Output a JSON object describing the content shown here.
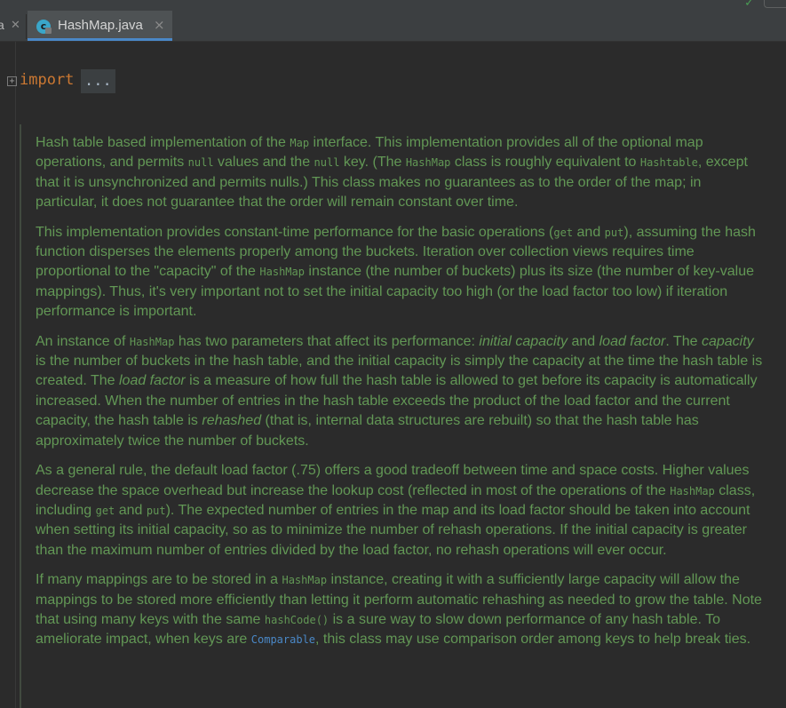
{
  "tabs": {
    "prev_fragment": "a",
    "active": {
      "title": "HashMap.java",
      "icon": "java-class-icon"
    }
  },
  "editor": {
    "import_keyword": "import",
    "import_folded": "..."
  },
  "doc": {
    "colors": {
      "text": "#629755",
      "link": "#4a88c7"
    },
    "paragraphs": [
      [
        {
          "t": "Hash table based implementation of the "
        },
        {
          "t": "Map",
          "c": 1
        },
        {
          "t": " interface. This implementation provides all of the optional map operations, and permits "
        },
        {
          "t": "null",
          "c": 1
        },
        {
          "t": " values and the "
        },
        {
          "t": "null",
          "c": 1
        },
        {
          "t": " key. (The "
        },
        {
          "t": "HashMap",
          "c": 1
        },
        {
          "t": " class is roughly equivalent to "
        },
        {
          "t": "Hashtable",
          "c": 1
        },
        {
          "t": ", except that it is unsynchronized and permits nulls.) This class makes no guarantees as to the order of the map; in particular, it does not guarantee that the order will remain constant over time."
        }
      ],
      [
        {
          "t": "This implementation provides constant-time performance for the basic operations ("
        },
        {
          "t": "get",
          "c": 1
        },
        {
          "t": " and "
        },
        {
          "t": "put",
          "c": 1
        },
        {
          "t": "), assuming the hash function disperses the elements properly among the buckets. Iteration over collection views requires time proportional to the \"capacity\" of the "
        },
        {
          "t": "HashMap",
          "c": 1
        },
        {
          "t": " instance (the number of buckets) plus its size (the number of key-value mappings). Thus, it's very important not to set the initial capacity too high (or the load factor too low) if iteration performance is important."
        }
      ],
      [
        {
          "t": "An instance of "
        },
        {
          "t": "HashMap",
          "c": 1
        },
        {
          "t": " has two parameters that affect its performance: "
        },
        {
          "t": "initial capacity",
          "i": 1
        },
        {
          "t": " and "
        },
        {
          "t": "load factor",
          "i": 1
        },
        {
          "t": ". The "
        },
        {
          "t": "capacity",
          "i": 1
        },
        {
          "t": " is the number of buckets in the hash table, and the initial capacity is simply the capacity at the time the hash table is created. The "
        },
        {
          "t": "load factor",
          "i": 1
        },
        {
          "t": " is a measure of how full the hash table is allowed to get before its capacity is automatically increased. When the number of entries in the hash table exceeds the product of the load factor and the current capacity, the hash table is "
        },
        {
          "t": "rehashed",
          "i": 1
        },
        {
          "t": " (that is, internal data structures are rebuilt) so that the hash table has approximately twice the number of buckets."
        }
      ],
      [
        {
          "t": "As a general rule, the default load factor (.75) offers a good tradeoff between time and space costs. Higher values decrease the space overhead but increase the lookup cost (reflected in most of the operations of the "
        },
        {
          "t": "HashMap",
          "c": 1
        },
        {
          "t": " class, including "
        },
        {
          "t": "get",
          "c": 1
        },
        {
          "t": " and "
        },
        {
          "t": "put",
          "c": 1
        },
        {
          "t": "). The expected number of entries in the map and its load factor should be taken into account when setting its initial capacity, so as to minimize the number of rehash operations. If the initial capacity is greater than the maximum number of entries divided by the load factor, no rehash operations will ever occur."
        }
      ],
      [
        {
          "t": "If many mappings are to be stored in a "
        },
        {
          "t": "HashMap",
          "c": 1
        },
        {
          "t": " instance, creating it with a sufficiently large capacity will allow the mappings to be stored more efficiently than letting it perform automatic rehashing as needed to grow the table. Note that using many keys with the same "
        },
        {
          "t": "hashCode()",
          "c": 1
        },
        {
          "t": " is a sure way to slow down performance of any hash table. To ameliorate impact, when keys are "
        },
        {
          "t": "Comparable",
          "c": 1,
          "l": 1
        },
        {
          "t": ", this class may use comparison order among keys to help break ties."
        }
      ]
    ]
  }
}
